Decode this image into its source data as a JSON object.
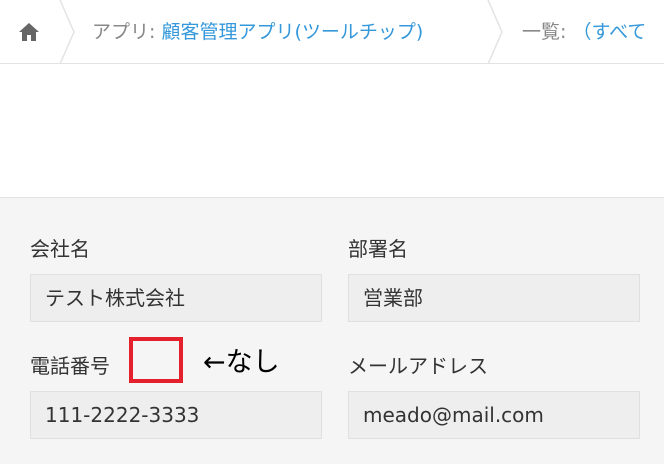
{
  "breadcrumb": {
    "home_icon": "home-icon",
    "app_prefix": "アプリ: ",
    "app_name": "顧客管理アプリ(ツールチップ)",
    "list_prefix": "一覧: ",
    "list_name": "（すべて"
  },
  "form": {
    "company": {
      "label": "会社名",
      "value": "テスト株式会社"
    },
    "department": {
      "label": "部署名",
      "value": "営業部"
    },
    "phone": {
      "label": "電話番号",
      "value": "111-2222-3333"
    },
    "email": {
      "label": "メールアドレス",
      "value": "meado@mail.com"
    }
  },
  "annotation": {
    "note": "←なし",
    "box_color": "#e4202c"
  },
  "colors": {
    "link": "#3498db",
    "field_bg": "#eeeeee",
    "page_bg": "#f5f5f5"
  }
}
